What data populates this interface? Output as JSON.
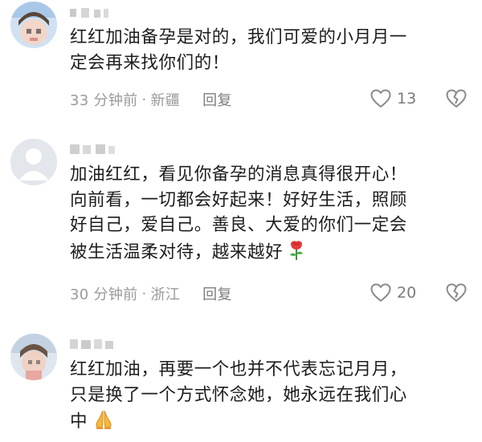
{
  "comments": [
    {
      "lines": [
        "红红加油备孕是对的，我们可爱的小月月一",
        "定会再来找你们的！"
      ],
      "time": "33 分钟前",
      "separator": "·",
      "location": "新疆",
      "reply": "回复",
      "likes": "13",
      "emoji": ""
    },
    {
      "lines": [
        "加油红红，看见你备孕的消息真得很开心！",
        "向前看，一切都会好起来！好好生活，照顾",
        "好自己，爱自己。善良、大爱的你们一定会",
        "被生活温柔对待，越来越好"
      ],
      "time": "30 分钟前",
      "separator": "·",
      "location": "浙江",
      "reply": "回复",
      "likes": "20",
      "emoji": "rose-emoji"
    },
    {
      "lines": [
        "红红加油，再要一个也并不代表忘记月月，",
        "只是换了一个方式怀念她，她永远在我们心",
        "中"
      ],
      "emoji": "praying-hands-emoji"
    }
  ],
  "icons": {
    "like": "heart-outline-icon",
    "dislike": "broken-heart-outline-icon"
  },
  "colors": {
    "text": "#1c1c1c",
    "meta": "#9a9a9a",
    "reply": "#7d7d7d",
    "icon": "#8a8a8a"
  }
}
